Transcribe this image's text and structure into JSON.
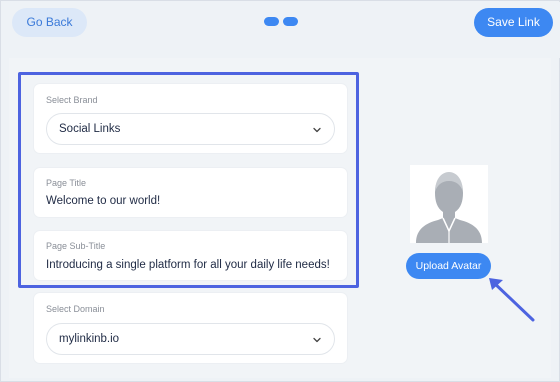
{
  "header": {
    "go_back_label": "Go Back",
    "save_link_label": "Save Link"
  },
  "brand": {
    "label": "Select Brand",
    "selected": "Social Links"
  },
  "page_title": {
    "label": "Page Title",
    "value": "Welcome to our world!"
  },
  "page_subtitle": {
    "label": "Page Sub-Title",
    "value": "Introducing a single platform for all your daily life needs!"
  },
  "domain": {
    "label": "Select Domain",
    "selected": "mylinkinb.io"
  },
  "avatar": {
    "upload_label": "Upload Avatar"
  },
  "colors": {
    "accent": "#3d88f2",
    "highlight": "#4d63e0",
    "background": "#eef2f6"
  }
}
